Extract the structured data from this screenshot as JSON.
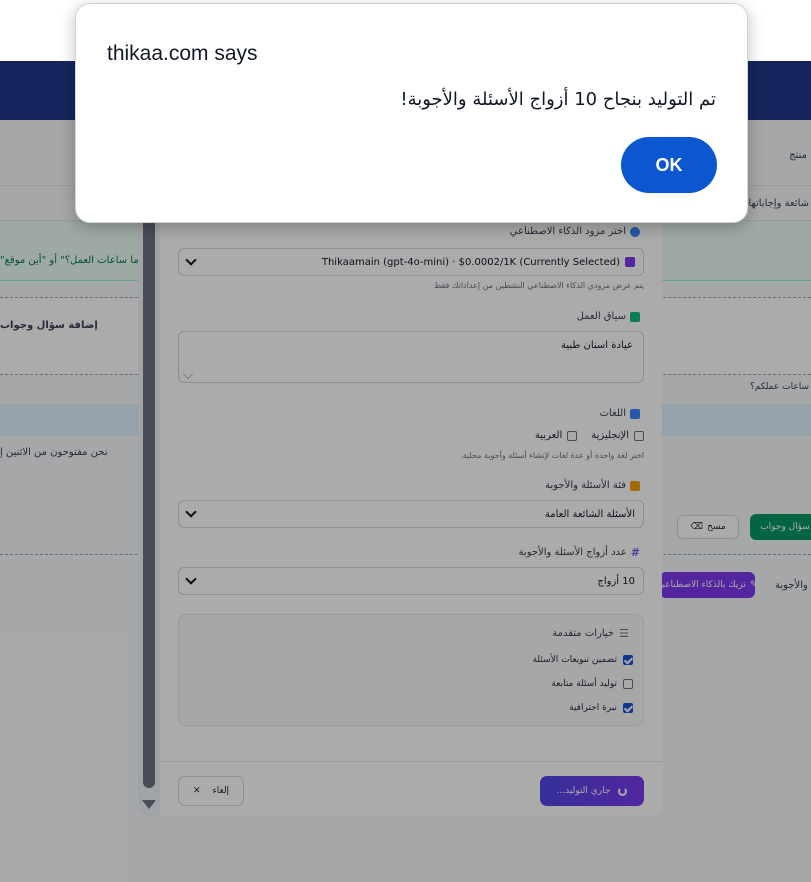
{
  "alert": {
    "title": "thikaa.com says",
    "message": "تم التوليد بنجاح 10 أزواج الأسئلة والأجوبة!",
    "ok_label": "OK"
  },
  "background": {
    "green_row_text": "\"ما ساعات العمل؟\" أو \"أين موقع",
    "add_pair_text": "إضافة سؤال وجواب",
    "hours_hint": "ساعات عملكم؟",
    "placeholder_text": "نحن مفتوحون من الاثنين إ",
    "add_button": "سؤال وجواب",
    "clear_button": "مسح",
    "polish_button": "تزيك بالذكاء الاصطناعي",
    "qa_label": "والأجوبة",
    "top_right_text": "منتج",
    "faq_text": "شائعة وإجاباتها"
  },
  "modal": {
    "provider": {
      "label": "اختر مزود الذكاء الاصطناعي",
      "selected": "Thikaamain (gpt-4o-mini) · $0.0002/1K (Currently Selected)",
      "hint": "يتم عرض مزودي الذكاء الاصطناعي النشطين من إعداداتك فقط"
    },
    "context": {
      "label": "سياق العمل",
      "value": "عيادة اسنان طبية"
    },
    "languages": {
      "label": "اللغات",
      "english": "الإنجليزية",
      "arabic": "العربية",
      "hint": "اختر لغة واحدة أو عدة لغات لإنشاء أسئلة وأجوبة محلية."
    },
    "category": {
      "label": "فئة الأسئلة والأجوبة",
      "selected": "الأسئلة الشائعة العامة"
    },
    "count": {
      "label": "عدد أزواج الأسئلة والأجوبة",
      "selected": "10 أزواج"
    },
    "advanced": {
      "title": "خيارات متقدمة",
      "opt1": "تضمين تنويعات الأسئلة",
      "opt2": "توليد أسئلة متابعة",
      "opt3": "نبرة احترافية"
    },
    "footer": {
      "cancel": "إلغاء",
      "generating": "جاري التوليد..."
    }
  },
  "colors": {
    "ok_button": "#0b57d0",
    "header_bg": "#1e3a8a",
    "generate_gradient_start": "#4f46e5",
    "generate_gradient_end": "#7c3aed"
  }
}
